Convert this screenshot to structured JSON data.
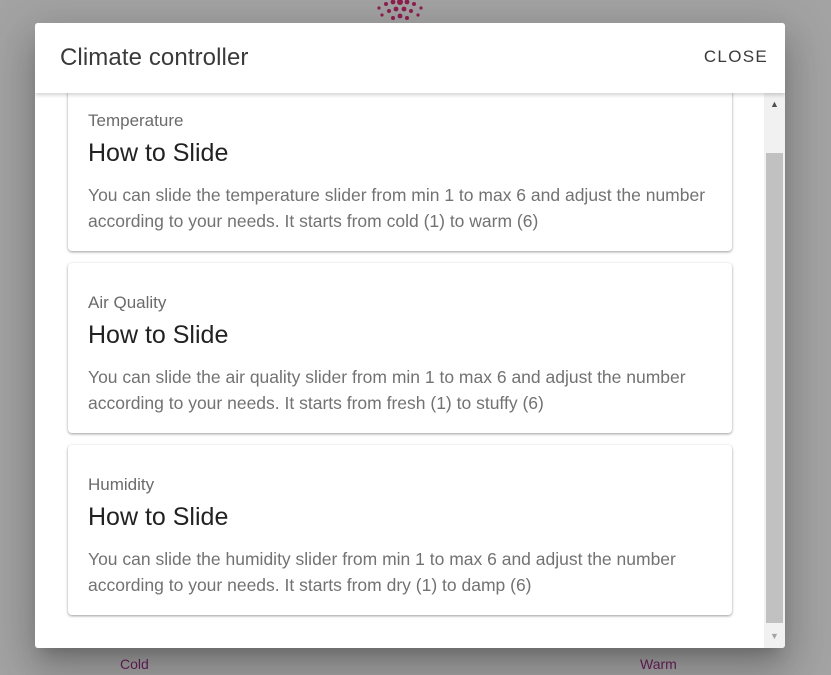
{
  "background": {
    "slider_min_label": "Cold",
    "slider_max_label": "Warm",
    "accent_color": "#b0185a"
  },
  "dialog": {
    "title": "Climate controller",
    "close_label": "CLOSE"
  },
  "cards": [
    {
      "overline": "Temperature",
      "title": "How to Slide",
      "text": "You can slide the temperature slider from min 1 to max 6 and adjust the number according to your needs. It starts from cold (1) to warm (6)"
    },
    {
      "overline": "Air Quality",
      "title": "How to Slide",
      "text": "You can slide the air quality slider from min 1 to max 6 and adjust the number according to your needs. It starts from fresh (1) to stuffy (6)"
    },
    {
      "overline": "Humidity",
      "title": "How to Slide",
      "text": "You can slide the humidity slider from min 1 to max 6 and adjust the number according to your needs. It starts from dry (1) to damp (6)"
    }
  ],
  "scrollbar": {
    "up_icon": "triangle-up-icon",
    "down_icon": "triangle-down-icon"
  }
}
